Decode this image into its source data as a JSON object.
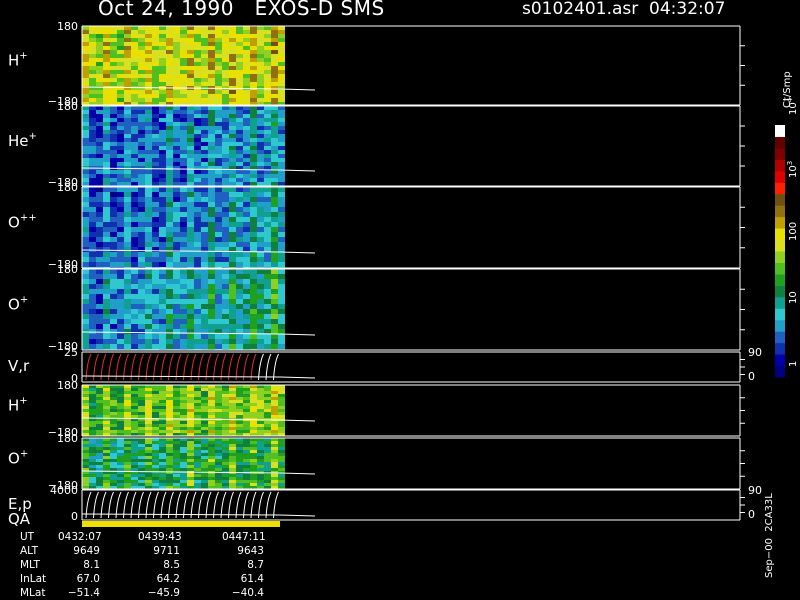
{
  "header": {
    "title": "Oct 24, 1990   EXOS-D SMS",
    "file": "s0102401.asr  04:32:07"
  },
  "chart_data": {
    "type": "heatmap",
    "panels": [
      {
        "id": "h1",
        "label": "H",
        "sup": "+",
        "ymax": "180",
        "ymin": "−180",
        "kind": "spec",
        "base": 0.62,
        "trend": 0.05
      },
      {
        "id": "he1",
        "label": "He",
        "sup": "+",
        "ymax": "180",
        "ymin": "−180",
        "kind": "spec",
        "base": 0.16,
        "trend": 0.1
      },
      {
        "id": "opp",
        "label": "O",
        "sup": "++",
        "ymax": "180",
        "ymin": "−180",
        "kind": "spec",
        "base": 0.14,
        "trend": 0.16
      },
      {
        "id": "op1",
        "label": "O",
        "sup": "+",
        "ymax": "180",
        "ymin": "−180",
        "kind": "spec",
        "base": 0.18,
        "trend": 0.22
      },
      {
        "id": "vr",
        "label": "V,r",
        "sup": "",
        "ymax": "25",
        "ymin": "0",
        "kind": "line",
        "right_top": "90",
        "right_bot": "0"
      },
      {
        "id": "h2",
        "label": "H",
        "sup": "+",
        "ymax": "180",
        "ymin": "−180",
        "kind": "spec",
        "base": 0.5,
        "trend": 0.1
      },
      {
        "id": "op2",
        "label": "O",
        "sup": "+",
        "ymax": "180",
        "ymin": "−180",
        "kind": "spec",
        "base": 0.38,
        "trend": 0.1
      },
      {
        "id": "ep",
        "label": "E,p",
        "sup": "",
        "ymax": "4000",
        "ymin": "0",
        "kind": "line",
        "right_top": "90",
        "right_bot": "0"
      }
    ],
    "qa_label": "QA",
    "colorbar": {
      "unit": "Ct/Smp",
      "ticks": [
        "1",
        "10",
        "100",
        "10^3",
        "10^4"
      ],
      "colors": [
        "#000080",
        "#0000a8",
        "#1030b0",
        "#2060c0",
        "#20a0c8",
        "#30c8d0",
        "#10a090",
        "#108040",
        "#20a020",
        "#50c020",
        "#90d020",
        "#d8e020",
        "#e8e000",
        "#c0a000",
        "#907010",
        "#705010",
        "#ff2000",
        "#e00000",
        "#b00000",
        "#800000",
        "#600000",
        "#ffffff"
      ]
    }
  },
  "orbit": {
    "rows": [
      {
        "label": "UT",
        "v": [
          "0432:07",
          "0439:43",
          "0447:11"
        ]
      },
      {
        "label": "ALT",
        "v": [
          "9649",
          "9711",
          "9643"
        ]
      },
      {
        "label": "MLT",
        "v": [
          "8.1",
          "8.5",
          "8.7"
        ]
      },
      {
        "label": "InLat",
        "v": [
          "67.0",
          "64.2",
          "61.4"
        ]
      },
      {
        "label": "MLat",
        "v": [
          "−51.4",
          "−45.9",
          "−40.4"
        ]
      }
    ]
  },
  "version_label": "Sep−00  2CA33L"
}
